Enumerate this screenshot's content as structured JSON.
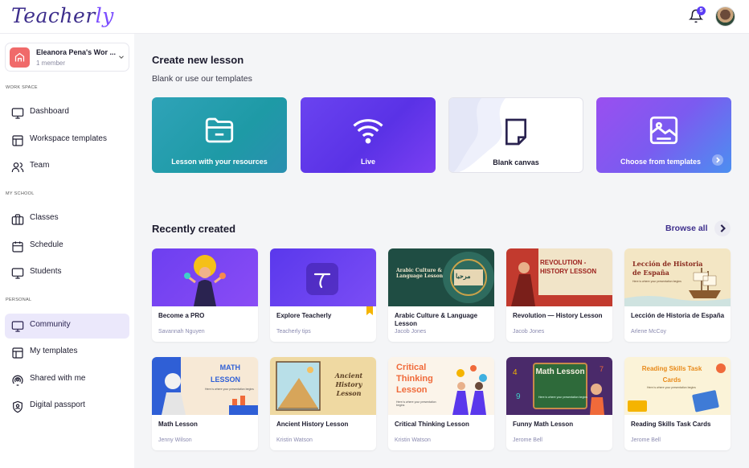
{
  "app": {
    "logo_main": "Teacher",
    "logo_accent": "ly"
  },
  "header": {
    "notification_count": "5"
  },
  "workspace": {
    "name": "Eleanora Pena's Wor ...",
    "members": "1 member"
  },
  "sidebar": {
    "sections": [
      "WORK SPACE",
      "MY SCHOOL",
      "PERSONAL"
    ],
    "items": [
      {
        "label": "Dashboard",
        "icon": "monitor-icon"
      },
      {
        "label": "Workspace templates",
        "icon": "layout-icon"
      },
      {
        "label": "Team",
        "icon": "users-icon"
      },
      {
        "label": "Classes",
        "icon": "briefcase-icon"
      },
      {
        "label": "Schedule",
        "icon": "calendar-icon"
      },
      {
        "label": "Students",
        "icon": "monitor-icon"
      },
      {
        "label": "Community",
        "icon": "monitor-icon",
        "active": true
      },
      {
        "label": "My templates",
        "icon": "layout-icon"
      },
      {
        "label": "Shared with me",
        "icon": "broadcast-icon"
      },
      {
        "label": "Digital passport",
        "icon": "shield-user-icon"
      }
    ]
  },
  "create": {
    "title": "Create new lesson",
    "subtitle": "Blank or use our templates",
    "cards": [
      {
        "label": "Lesson with your resources",
        "icon": "folder-icon"
      },
      {
        "label": "Live",
        "icon": "wifi-icon"
      },
      {
        "label": "Blank canvas",
        "icon": "page-icon"
      },
      {
        "label": "Choose from templates",
        "icon": "template-icon"
      }
    ]
  },
  "recent": {
    "title": "Recently created",
    "browse_label": "Browse all",
    "lessons": [
      {
        "title": "Become a PRO",
        "author": "Savannah Nguyen"
      },
      {
        "title": "Explore Teacherly",
        "author": "Teacherly tips"
      },
      {
        "title": "Arabic Culture & Language Lesson",
        "author": "Jacob Jones",
        "thumb_title": "Arabic Culture & Language Lesson",
        "thumb_sub": "مرحبا"
      },
      {
        "title": "Revolution — History Lesson",
        "author": "Jacob Jones",
        "thumb_title": "REVOLUTION - HISTORY LESSON"
      },
      {
        "title": "Lección de Historia de España",
        "author": "Arlene McCoy",
        "thumb_title": "Lección de Historia de España",
        "thumb_sub": "Here is where your presentation begins"
      },
      {
        "title": "Math Lesson",
        "author": "Jenny Wilson",
        "thumb_title": "MATH LESSON",
        "thumb_sub": "Here is where your presentation begins"
      },
      {
        "title": "Ancient History Lesson",
        "author": "Kristin Watson",
        "thumb_title": "Ancient History Lesson"
      },
      {
        "title": "Critical Thinking Lesson",
        "author": "Kristin Watson",
        "thumb_title": "Critical Thinking Lesson",
        "thumb_sub": "Here is where your presentation begins"
      },
      {
        "title": "Funny Math Lesson",
        "author": "Jerome Bell",
        "thumb_title": "Math Lesson",
        "thumb_sub": "Here is where your presentation begins"
      },
      {
        "title": "Reading Skills Task Cards",
        "author": "Jerome Bell",
        "thumb_title": "Reading Skills Task Cards",
        "thumb_sub": "Here is where your presentation begins"
      }
    ]
  },
  "colors": {
    "brand": "#5b3df5",
    "active_bg": "#ebe8fb",
    "accent_text": "#3d2e8c"
  }
}
